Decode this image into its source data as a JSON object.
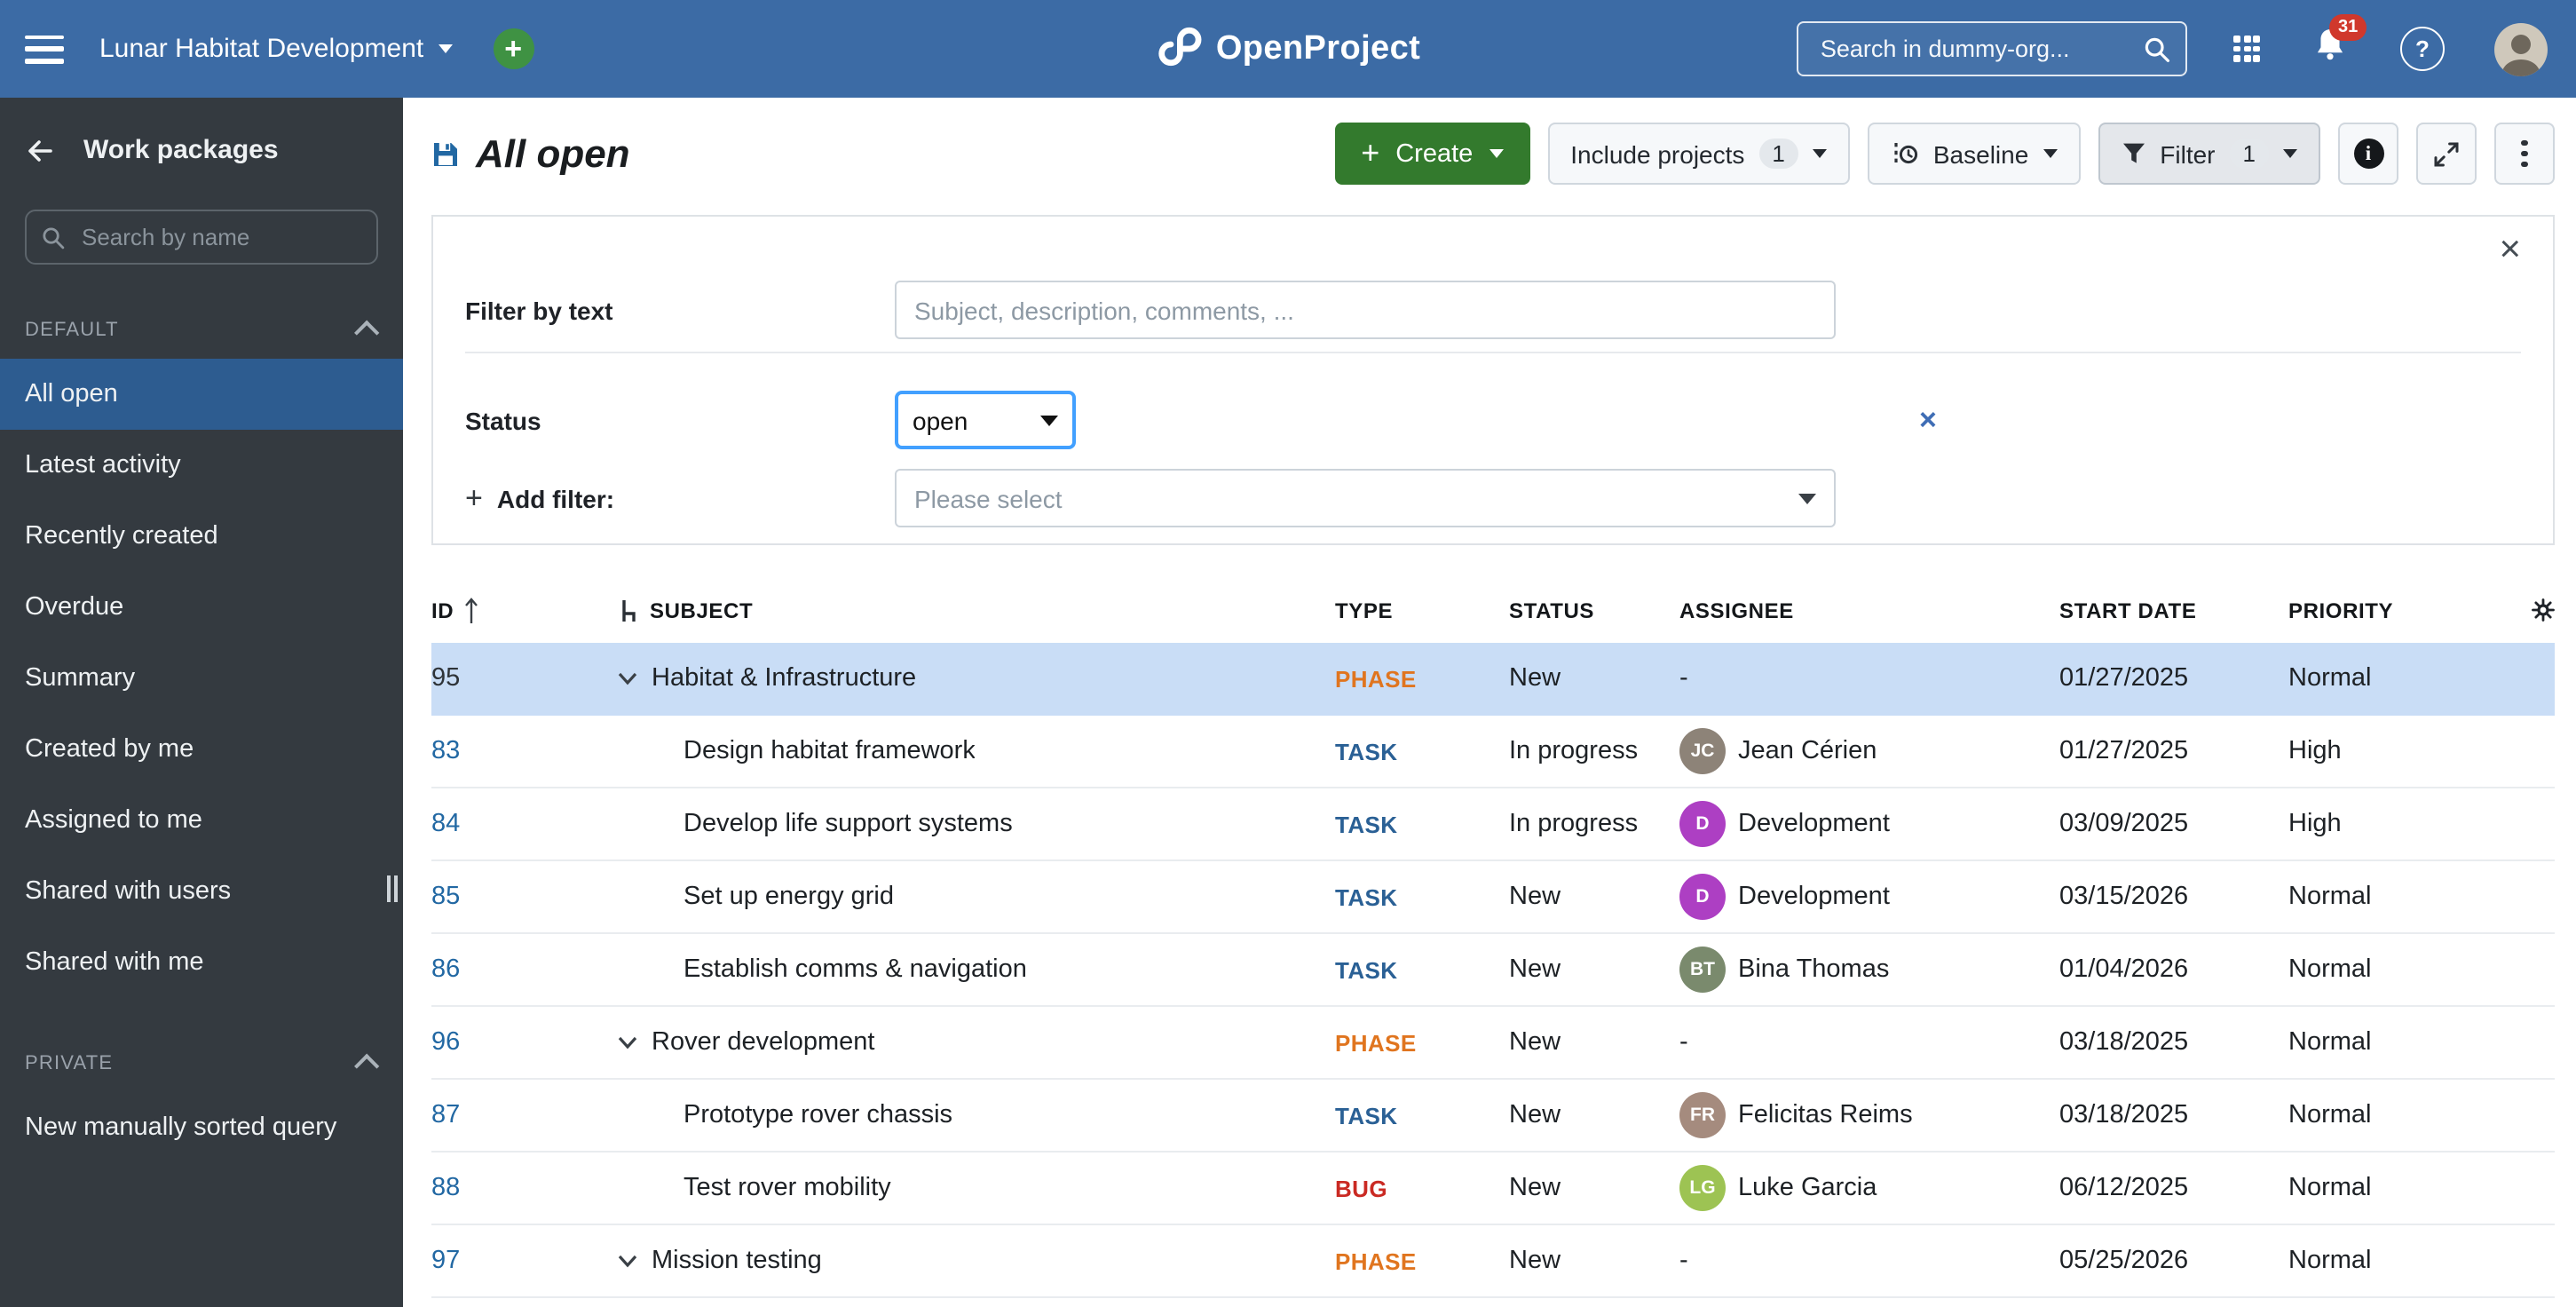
{
  "topbar": {
    "project_name": "Lunar Habitat Development",
    "app_name": "OpenProject",
    "search_placeholder": "Search in dummy-org...",
    "notification_count": "31"
  },
  "sidebar": {
    "title": "Work packages",
    "search_placeholder": "Search by name",
    "sections": [
      {
        "label": "DEFAULT",
        "items": [
          {
            "label": "All open",
            "active": true
          },
          {
            "label": "Latest activity",
            "active": false
          },
          {
            "label": "Recently created",
            "active": false
          },
          {
            "label": "Overdue",
            "active": false
          },
          {
            "label": "Summary",
            "active": false
          },
          {
            "label": "Created by me",
            "active": false
          },
          {
            "label": "Assigned to me",
            "active": false
          },
          {
            "label": "Shared with users",
            "active": false
          },
          {
            "label": "Shared with me",
            "active": false
          }
        ]
      },
      {
        "label": "PRIVATE",
        "items": [
          {
            "label": "New manually sorted query",
            "active": false
          }
        ]
      }
    ]
  },
  "toolbar": {
    "title": "All open",
    "create_label": "Create",
    "include_projects_label": "Include projects",
    "include_projects_count": "1",
    "baseline_label": "Baseline",
    "filter_label": "Filter",
    "filter_count": "1"
  },
  "filter_panel": {
    "text_filter_label": "Filter by text",
    "text_filter_placeholder": "Subject, description, comments, ...",
    "status_label": "Status",
    "status_value": "open",
    "add_filter_label": "Add filter:",
    "add_filter_placeholder": "Please select"
  },
  "table": {
    "columns": [
      "ID",
      "SUBJECT",
      "TYPE",
      "STATUS",
      "ASSIGNEE",
      "START DATE",
      "PRIORITY"
    ],
    "type_colors": {
      "PHASE": "#e0751f",
      "TASK": "#2a6095",
      "BUG": "#ca2a23"
    },
    "rows": [
      {
        "id": "95",
        "expandable": true,
        "indent": 0,
        "subject": "Habitat & Infrastructure",
        "type": "PHASE",
        "status": "New",
        "assignee": null,
        "start_date": "01/27/2025",
        "priority": "Normal",
        "highlighted": true
      },
      {
        "id": "83",
        "expandable": false,
        "indent": 1,
        "subject": "Design habitat framework",
        "type": "TASK",
        "status": "In progress",
        "assignee": {
          "name": "Jean Cérien",
          "initials": "JC",
          "color": "#8d8378"
        },
        "start_date": "01/27/2025",
        "priority": "High",
        "highlighted": false
      },
      {
        "id": "84",
        "expandable": false,
        "indent": 1,
        "subject": "Develop life support systems",
        "type": "TASK",
        "status": "In progress",
        "assignee": {
          "name": "Development",
          "initials": "D",
          "color": "#ad3fc3"
        },
        "start_date": "03/09/2025",
        "priority": "High",
        "highlighted": false
      },
      {
        "id": "85",
        "expandable": false,
        "indent": 1,
        "subject": "Set up energy grid",
        "type": "TASK",
        "status": "New",
        "assignee": {
          "name": "Development",
          "initials": "D",
          "color": "#ad3fc3"
        },
        "start_date": "03/15/2026",
        "priority": "Normal",
        "highlighted": false
      },
      {
        "id": "86",
        "expandable": false,
        "indent": 1,
        "subject": "Establish comms & navigation",
        "type": "TASK",
        "status": "New",
        "assignee": {
          "name": "Bina Thomas",
          "initials": "BT",
          "color": "#7a8a6d"
        },
        "start_date": "01/04/2026",
        "priority": "Normal",
        "highlighted": false
      },
      {
        "id": "96",
        "expandable": true,
        "indent": 0,
        "subject": "Rover development",
        "type": "PHASE",
        "status": "New",
        "assignee": null,
        "start_date": "03/18/2025",
        "priority": "Normal",
        "highlighted": false
      },
      {
        "id": "87",
        "expandable": false,
        "indent": 1,
        "subject": "Prototype rover chassis",
        "type": "TASK",
        "status": "New",
        "assignee": {
          "name": "Felicitas Reims",
          "initials": "FR",
          "color": "#a58b7e"
        },
        "start_date": "03/18/2025",
        "priority": "Normal",
        "highlighted": false
      },
      {
        "id": "88",
        "expandable": false,
        "indent": 1,
        "subject": "Test rover mobility",
        "type": "BUG",
        "status": "New",
        "assignee": {
          "name": "Luke Garcia",
          "initials": "LG",
          "color": "#9dc353"
        },
        "start_date": "06/12/2025",
        "priority": "Normal",
        "highlighted": false
      },
      {
        "id": "97",
        "expandable": true,
        "indent": 0,
        "subject": "Mission testing",
        "type": "PHASE",
        "status": "New",
        "assignee": null,
        "start_date": "05/25/2026",
        "priority": "Normal",
        "highlighted": false
      }
    ]
  }
}
